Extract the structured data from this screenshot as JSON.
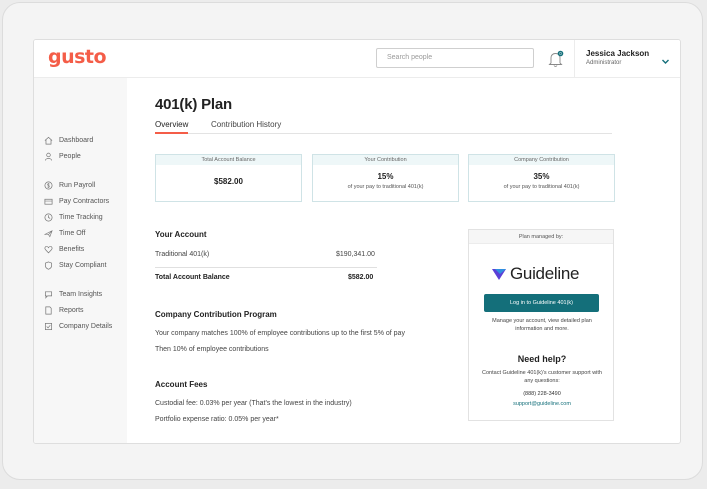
{
  "app": {
    "logo": "gusto"
  },
  "header": {
    "search_placeholder": "Search people",
    "notification_badge": "0",
    "user_name": "Jessica Jackson",
    "user_role": "Administrator"
  },
  "sidebar": {
    "items": [
      {
        "label": "Dashboard",
        "icon": "home-icon"
      },
      {
        "label": "People",
        "icon": "person-icon"
      },
      {
        "label": "Run Payroll",
        "icon": "dollar-icon"
      },
      {
        "label": "Pay Contractors",
        "icon": "wallet-icon"
      },
      {
        "label": "Time Tracking",
        "icon": "clock-icon"
      },
      {
        "label": "Time Off",
        "icon": "plane-icon"
      },
      {
        "label": "Benefits",
        "icon": "heart-icon"
      },
      {
        "label": "Stay Compliant",
        "icon": "shield-icon"
      },
      {
        "label": "Team Insights",
        "icon": "chat-icon"
      },
      {
        "label": "Reports",
        "icon": "document-icon"
      },
      {
        "label": "Company Details",
        "icon": "checklist-icon"
      }
    ]
  },
  "page": {
    "title": "401(k) Plan",
    "tabs": [
      "Overview",
      "Contribution History"
    ],
    "active_tab": "Overview"
  },
  "cards": [
    {
      "label": "Total Account Balance",
      "value": "$582.00",
      "sub": ""
    },
    {
      "label": "Your Contribution",
      "value": "15%",
      "sub": "of your pay to traditional 401(k)"
    },
    {
      "label": "Company Contribution",
      "value": "35%",
      "sub": "of your pay to traditional 401(k)"
    }
  ],
  "account": {
    "heading": "Your Account",
    "rows": [
      {
        "label": "Traditional 401(k)",
        "value": "$190,341.00"
      },
      {
        "label": "Total Account Balance",
        "value": "$582.00"
      }
    ]
  },
  "program": {
    "heading": "Company Contribution Program",
    "lines": [
      "Your company matches 100% of employee contributions up to the first 5% of pay",
      "Then 10% of employee contributions"
    ]
  },
  "fees": {
    "heading": "Account Fees",
    "lines": [
      "Custodial fee: 0.03% per year (That's the lowest in the industry)",
      "Portfolio expense ratio: 0.05% per year*"
    ]
  },
  "guideline": {
    "managed_by": "Plan managed by:",
    "brand": "Guideline",
    "button": "Log in to Guideline 401(k)",
    "desc": "Manage your account, view detailed plan information and more.",
    "help_title": "Need help?",
    "help_desc": "Contact Guideline 401(k)'s customer support with any questions:",
    "phone": "(888) 228-3490",
    "email": "support@guideline.com"
  },
  "colors": {
    "brand": "#f45d48",
    "accent": "#146f7a",
    "card_border": "#cfe3e6"
  }
}
